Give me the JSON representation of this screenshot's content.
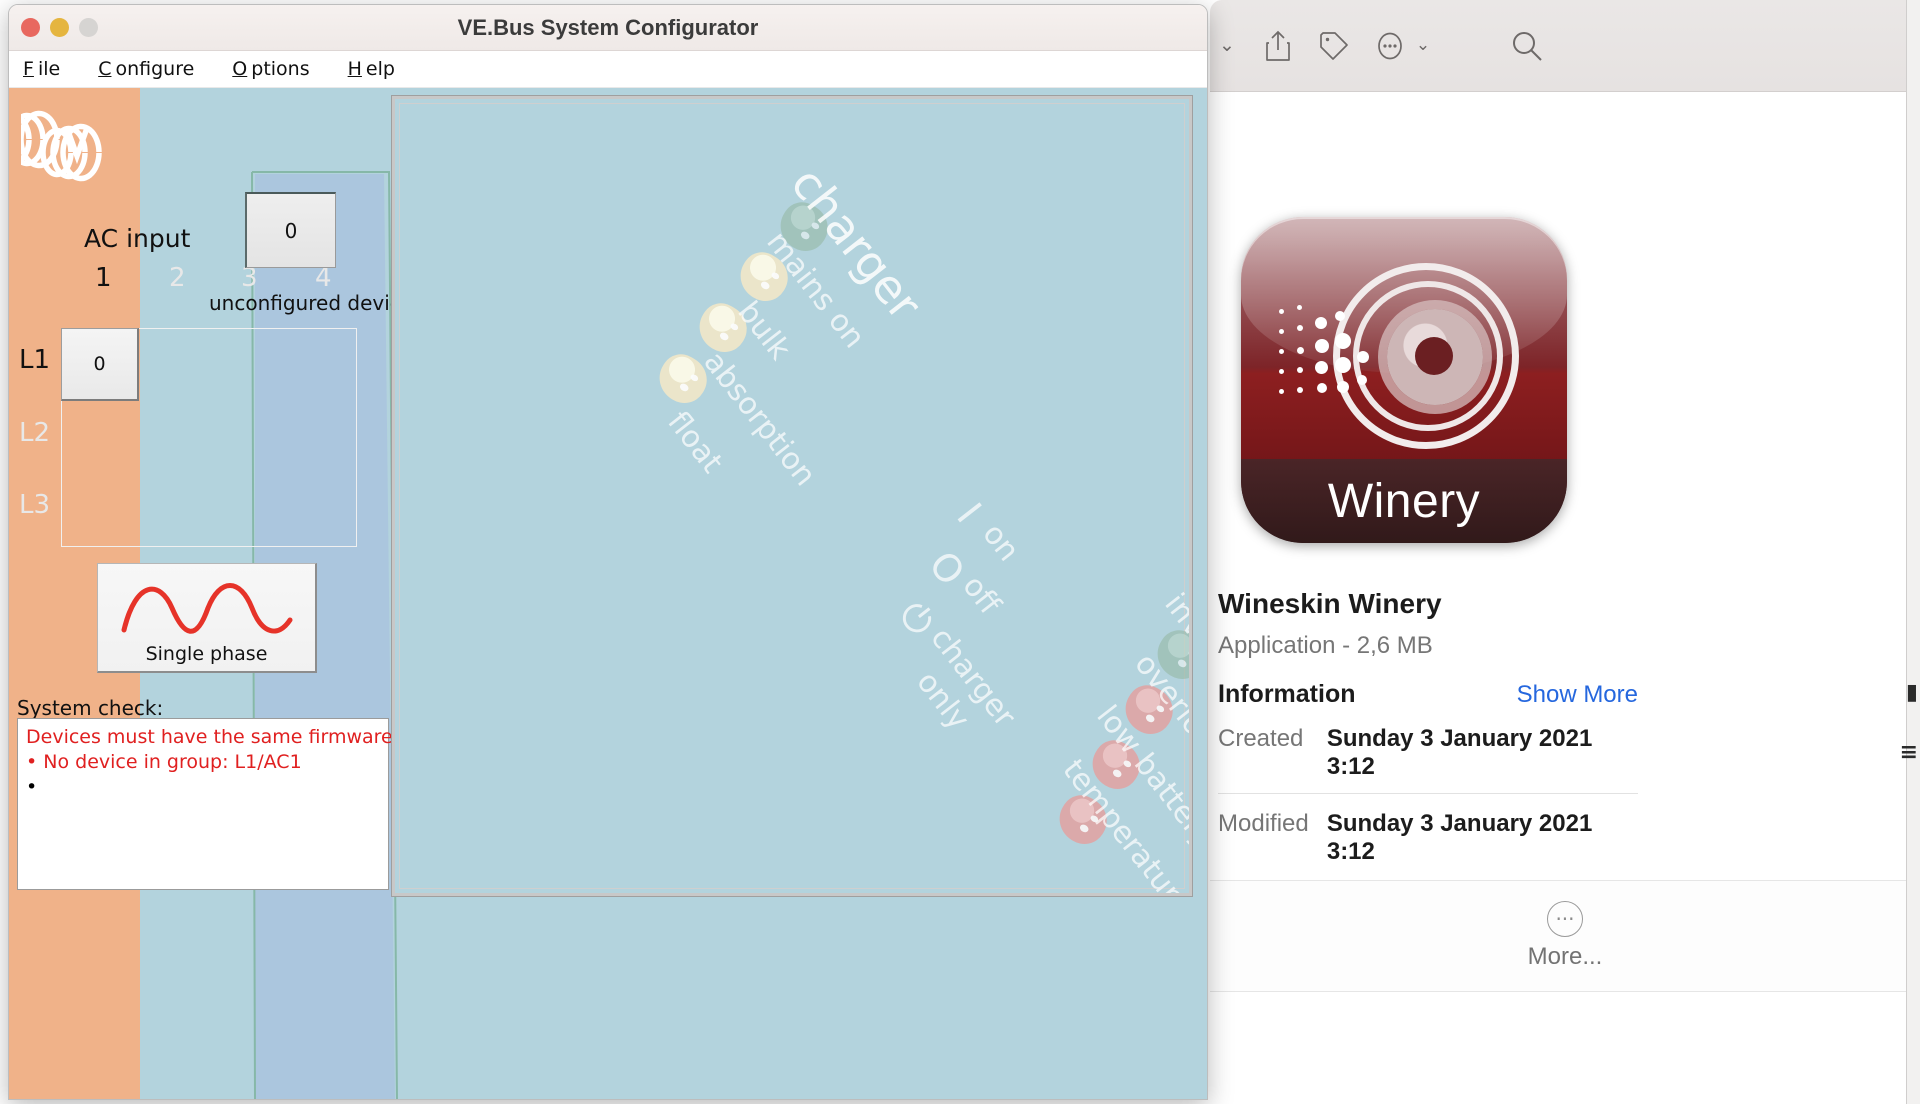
{
  "vebus": {
    "window_title": "VE.Bus System Configurator",
    "traffic_lights": [
      "close",
      "minimize",
      "zoom"
    ],
    "menu": [
      {
        "label": "File",
        "mnemonic": "F"
      },
      {
        "label": "Configure",
        "mnemonic": "C"
      },
      {
        "label": "Options",
        "mnemonic": "O"
      },
      {
        "label": "Help",
        "mnemonic": "H"
      }
    ],
    "logo_name": "victron-energy-logo",
    "ac_input_label": "AC input",
    "ac_input_columns": [
      {
        "label": "1",
        "active": true
      },
      {
        "label": "2",
        "active": false
      },
      {
        "label": "3",
        "active": false
      },
      {
        "label": "4",
        "active": false
      }
    ],
    "phase_rows": [
      {
        "label": "L1",
        "active": true
      },
      {
        "label": "L2",
        "active": false
      },
      {
        "label": "L3",
        "active": false
      }
    ],
    "grid_cell_value": "0",
    "unconfigured": {
      "count": "0",
      "label": "unconfigured devices:"
    },
    "phase_button": {
      "caption": "Single phase",
      "wave_color": "#e63329"
    },
    "system_check": {
      "label": "System check:",
      "messages": [
        {
          "text": "Devices must have the same firmware version!",
          "bullet": false,
          "color": "#e02020"
        },
        {
          "text": "No device in group: L1/AC1",
          "bullet": true,
          "color": "#e02020"
        },
        {
          "text": "",
          "bullet": true,
          "color": "#000000"
        }
      ]
    },
    "canvas": {
      "background": "#b3d3dd",
      "leds": [
        {
          "name": "mains-on-led",
          "color": "green"
        },
        {
          "name": "bulk-led",
          "color": "amber"
        },
        {
          "name": "absorption-led",
          "color": "amber"
        },
        {
          "name": "float-led",
          "color": "amber"
        },
        {
          "name": "inverter-led",
          "color": "green"
        },
        {
          "name": "overload-led",
          "color": "red"
        },
        {
          "name": "low-battery-led",
          "color": "red"
        },
        {
          "name": "temperature-led",
          "color": "red"
        }
      ],
      "labels": [
        {
          "text": "charger",
          "size": "big"
        },
        {
          "text": "mains on",
          "size": "mid"
        },
        {
          "text": "bulk",
          "size": "mid"
        },
        {
          "text": "absorption",
          "size": "mid"
        },
        {
          "text": "float",
          "size": "mid"
        },
        {
          "text": "on",
          "size": "mid"
        },
        {
          "text": "off",
          "size": "mid"
        },
        {
          "text": "charger",
          "size": "mid"
        },
        {
          "text": "only",
          "size": "mid"
        },
        {
          "text": "inverter",
          "size": "mid"
        },
        {
          "text": "overload",
          "size": "mid"
        },
        {
          "text": "low battery",
          "size": "mid"
        },
        {
          "text": "temperature",
          "size": "mid"
        }
      ],
      "symbols": [
        {
          "text": "I",
          "name": "switch-on-symbol"
        },
        {
          "text": "O",
          "name": "switch-off-symbol"
        },
        {
          "text": "⏻",
          "name": "standby-symbol"
        }
      ]
    }
  },
  "finder": {
    "toolbar": {
      "back_chevron": "⌄",
      "share_icon": "share-icon",
      "tag_icon": "tag-icon",
      "more_icon": "ellipsis-icon",
      "more_chevron": "⌄",
      "search_icon": "search-icon"
    },
    "app": {
      "icon_label": "Winery",
      "name": "Wineskin Winery",
      "subtitle": "Application - 2,6 MB"
    },
    "information": {
      "heading": "Information",
      "show_more": "Show More",
      "rows": [
        {
          "key": "Created",
          "value": "Sunday 3 January 2021 3:12"
        },
        {
          "key": "Modified",
          "value": "Sunday 3 January 2021 3:12"
        }
      ]
    },
    "more_button": {
      "label": "More...",
      "icon": "ellipsis-circle-icon"
    }
  }
}
